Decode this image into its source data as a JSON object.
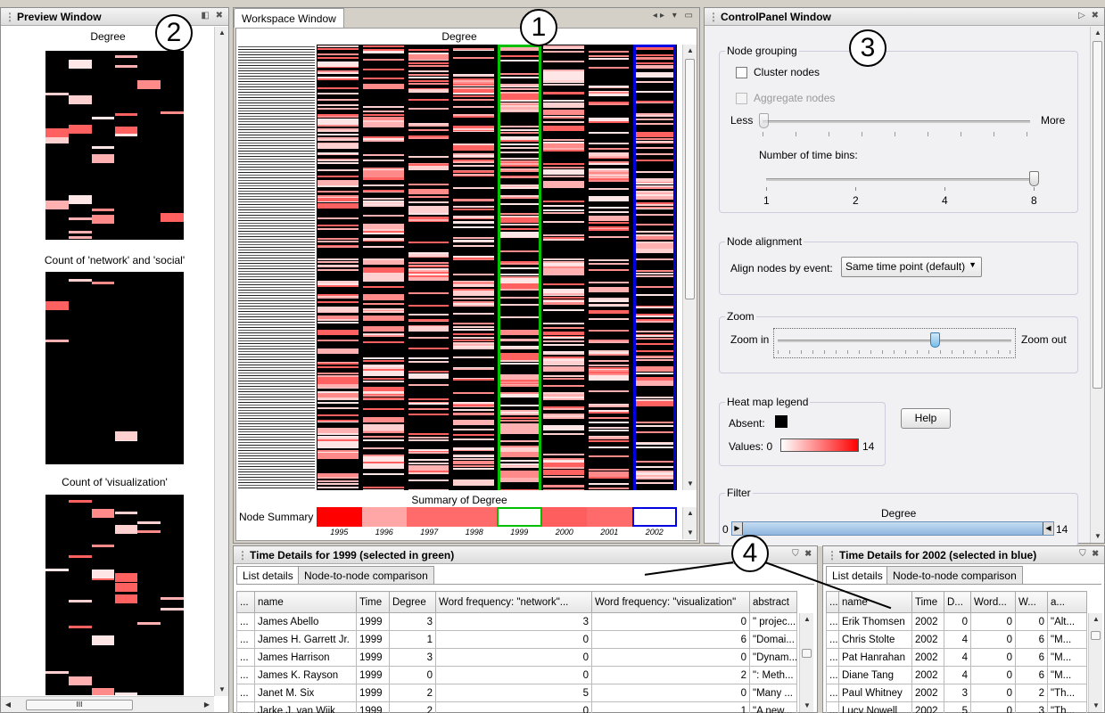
{
  "callouts": [
    "1",
    "2",
    "3",
    "4"
  ],
  "preview": {
    "title": "Preview Window",
    "charts": [
      {
        "label": "Degree"
      },
      {
        "label": "Count of 'network' and 'social'"
      },
      {
        "label": "Count of 'visualization'"
      }
    ],
    "hscroll_grip": "III"
  },
  "workspace": {
    "tab_label": "Workspace Window",
    "heatmap_title": "Degree",
    "summary_title": "Summary of Degree",
    "summary_row_label": "Node Summary",
    "years": [
      "1995",
      "1996",
      "1997",
      "1998",
      "1999",
      "2000",
      "2001",
      "2002"
    ],
    "summary_colors": [
      "#ff0000",
      "#ffa7a7",
      "#ff6b6b",
      "#ff6b6b",
      "#ffffff",
      "#ff5e5e",
      "#ff6b6b",
      "#ffffff"
    ],
    "selected_green_year": "1999",
    "selected_blue_year": "2002",
    "colors": {
      "green": "#00c000",
      "blue": "#0000e0"
    }
  },
  "control": {
    "title": "ControlPanel Window",
    "grouping": {
      "title": "Node grouping",
      "cluster_label": "Cluster nodes",
      "aggregate_label": "Aggregate nodes",
      "less": "Less",
      "more": "More",
      "bins_label": "Number of time bins:",
      "bins_ticks": [
        "1",
        "2",
        "4",
        "8"
      ],
      "bins_value": 8
    },
    "alignment": {
      "title": "Node alignment",
      "label": "Align nodes by event:",
      "selected": "Same time point (default)"
    },
    "zoom": {
      "title": "Zoom",
      "in": "Zoom in",
      "out": "Zoom out"
    },
    "legend": {
      "title": "Heat map legend",
      "absent": "Absent:",
      "values": "Values: 0",
      "max": "14",
      "help": "Help"
    },
    "filter": {
      "title": "Filter",
      "label": "Degree",
      "min": "0",
      "max": "14"
    }
  },
  "details_left": {
    "title": "Time Details for 1999 (selected in green)",
    "tabs": [
      "List details",
      "Node-to-node comparison"
    ],
    "columns": [
      "...",
      "name",
      "Time",
      "Degree",
      "Word frequency: \"network\"...",
      "Word frequency: \"visualization\"",
      "abstract"
    ],
    "rows": [
      [
        "...",
        "James Abello",
        "1999",
        "3",
        "3",
        "0",
        "\" projec..."
      ],
      [
        "...",
        "James H. Garrett Jr.",
        "1999",
        "1",
        "0",
        "6",
        "\"Domai..."
      ],
      [
        "...",
        "James Harrison",
        "1999",
        "3",
        "0",
        "0",
        "\"Dynam..."
      ],
      [
        "...",
        "James K. Rayson",
        "1999",
        "0",
        "0",
        "2",
        "\": Meth..."
      ],
      [
        "...",
        "Janet M. Six",
        "1999",
        "2",
        "5",
        "0",
        "\"Many ..."
      ],
      [
        "...",
        "Jarke J. van Wijk",
        "1999",
        "2",
        "0",
        "1",
        "\"A new..."
      ]
    ]
  },
  "details_right": {
    "title": "Time Details for 2002 (selected in blue)",
    "tabs": [
      "List details",
      "Node-to-node comparison"
    ],
    "columns": [
      "...",
      "name",
      "Time",
      "D...",
      "Word...",
      "W...",
      "a..."
    ],
    "rows": [
      [
        "...",
        "Erik Thomsen",
        "2002",
        "0",
        "0",
        "0",
        "\"Alt..."
      ],
      [
        "...",
        "Chris Stolte",
        "2002",
        "4",
        "0",
        "6",
        "\"M..."
      ],
      [
        "...",
        "Pat Hanrahan",
        "2002",
        "4",
        "0",
        "6",
        "\"M..."
      ],
      [
        "...",
        "Diane Tang",
        "2002",
        "4",
        "0",
        "6",
        "\"M..."
      ],
      [
        "...",
        "Paul Whitney",
        "2002",
        "3",
        "0",
        "2",
        "\"Th..."
      ],
      [
        "...",
        "Lucy Nowell",
        "2002",
        "5",
        "0",
        "3",
        "\"Th..."
      ]
    ]
  }
}
